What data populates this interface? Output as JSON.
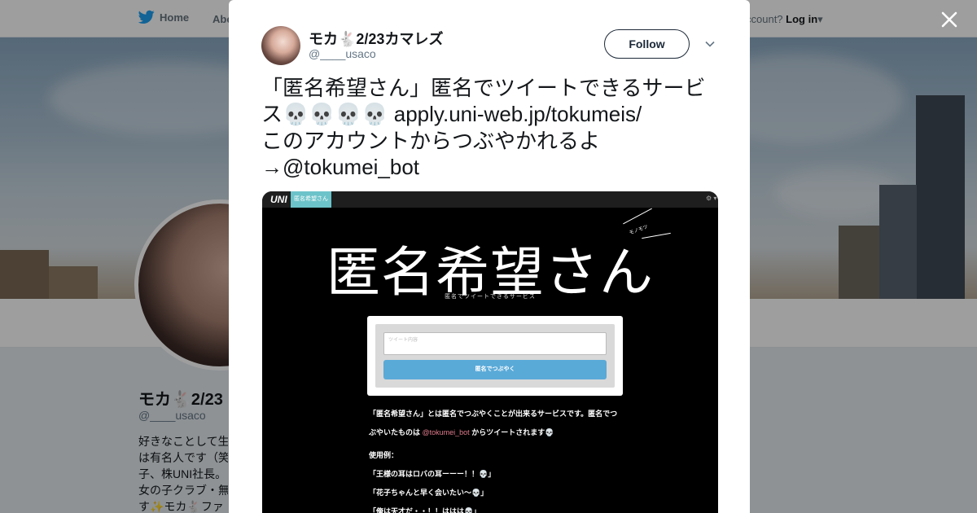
{
  "nav": {
    "home_label": "Home",
    "about_label": "Abo",
    "account_prompt": "ccount?",
    "login_label": "Log in"
  },
  "profile": {
    "name": "モカ🐇2/23",
    "handle": "@____usaco",
    "bio_lines": [
      "好きなことして生",
      "は有名人です（笑",
      "子、株UNI社長。",
      "女の子クラブ・無",
      "す✨モカ🐇ファ"
    ]
  },
  "tweet": {
    "author_name": "モカ🐇2/23カマレズ",
    "author_handle": "@____usaco",
    "follow_label": "Follow",
    "text_part1": "「匿名希望さん」匿名でツイートできるサービス",
    "skulls": "💀💀💀💀",
    "link_text": "apply.uni-web.jp/tokumeis/",
    "text_part2": "このアカウントからつぶやかれるよ→@tokumei_bot"
  },
  "media": {
    "logo": "UNI",
    "tab_label": "匿名希望さん",
    "gear": "⚙ ▾",
    "title": "匿名希望さん",
    "deco_text": "モノモツ",
    "subtitle": "匿名でツイートできるサービス",
    "input_placeholder": "ツイート内容",
    "submit_label": "匿名でつぶやく",
    "desc_line1": "「匿名希望さん」とは匿名でつぶやくことが出来るサービスです。匿名でつ",
    "desc_line2_a": "ぶやいたものは ",
    "desc_line2_link": "@tokumei_bot",
    "desc_line2_b": " からツイートされます💀",
    "usage_title": "使用例：",
    "usage_examples": [
      "「王様の耳はロバの耳ーーー！！💀」",
      "「花子ちゃんと早く会いたい〜💀」",
      "「俺は天才だ・・！！ははは💀」"
    ]
  }
}
